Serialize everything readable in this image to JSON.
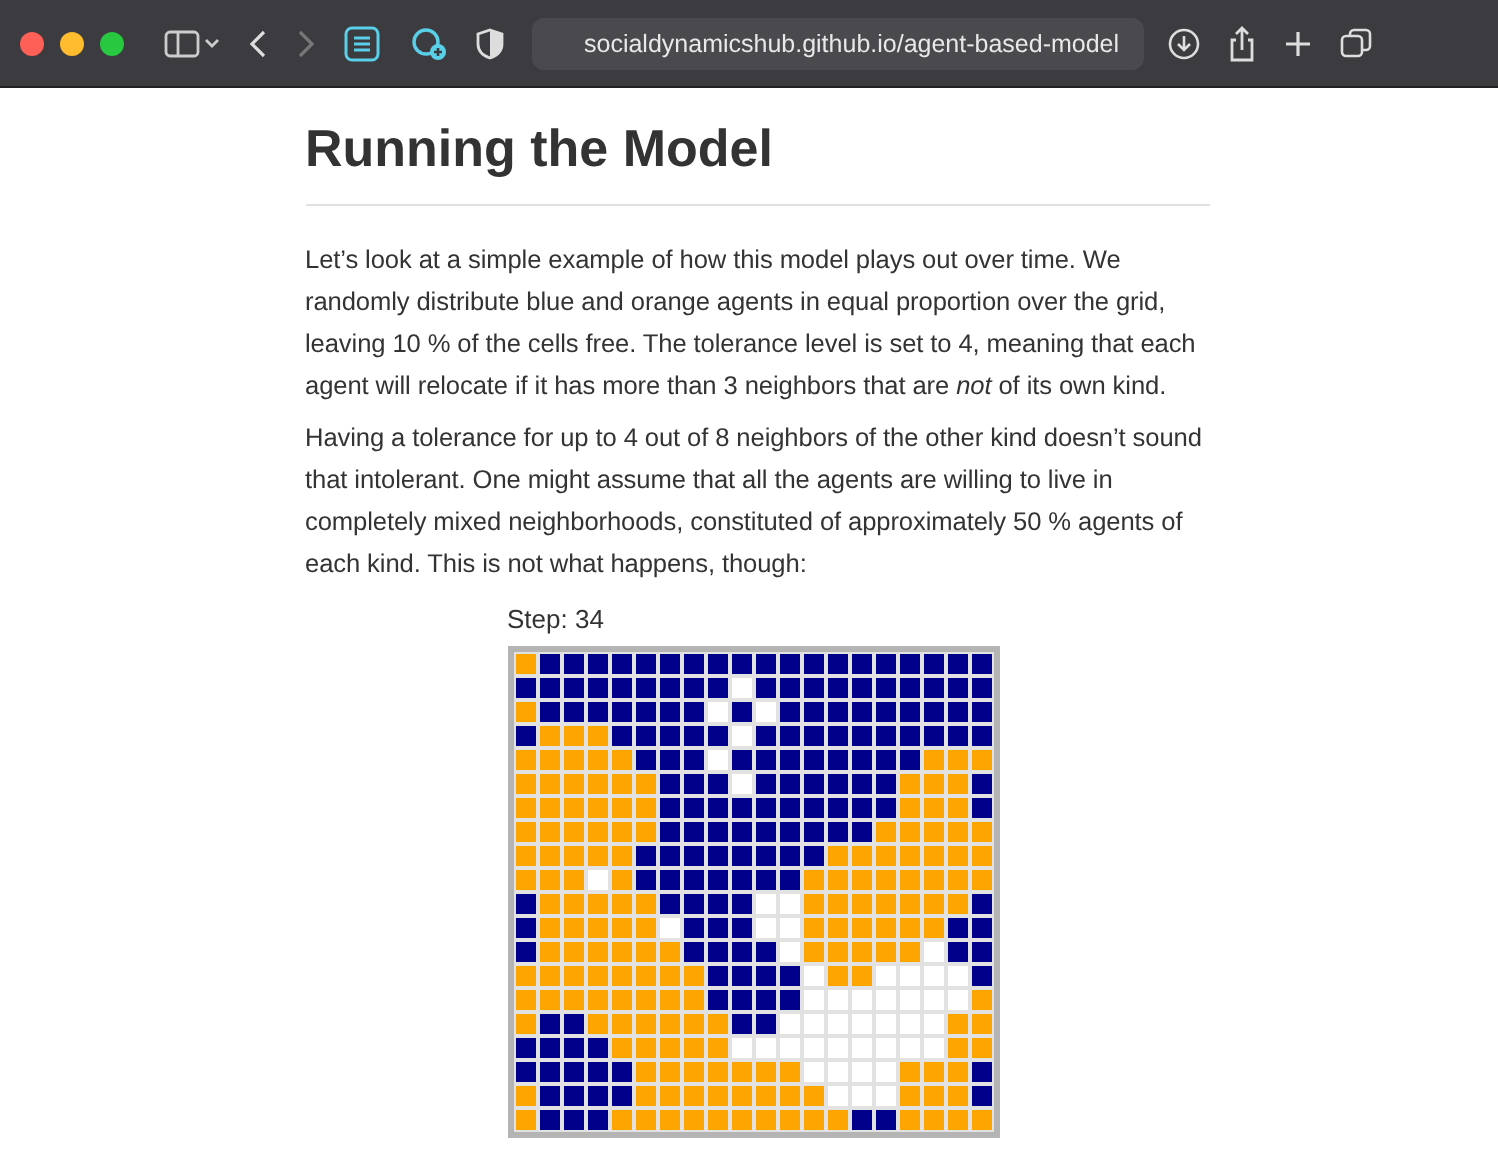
{
  "browser": {
    "url": "socialdynamicshub.github.io/agent-based-model"
  },
  "article": {
    "title": "Running the Model",
    "paragraphs": [
      "Let’s look at a simple example of how this model plays out over time. We randomly distribute blue and orange agents in equal proportion over the grid, leaving 10 % of the cells free. The tolerance level is set to 4, meaning that each agent will relocate if it has more than 3 neighbors that are *not* of its own kind.",
      "Having a tolerance for up to 4 out of 8 neighbors of the other kind doesn’t sound that intolerant. One might assume that all the agents are willing to live in completely mixed neighborhoods, constituted of approximately 50 % agents of each kind. This is not what happens, though:"
    ]
  },
  "simulation": {
    "step_label": "Step: 34",
    "rows": [
      [
        {
          "kind": "orange"
        },
        {
          "kind": "blue"
        },
        {
          "kind": "blue"
        },
        {
          "kind": "blue"
        },
        {
          "kind": "blue"
        },
        {
          "kind": "blue"
        },
        {
          "kind": "blue"
        },
        {
          "kind": "blue"
        },
        {
          "kind": "blue"
        },
        {
          "kind": "blue"
        },
        {
          "kind": "blue"
        },
        {
          "kind": "blue"
        },
        {
          "kind": "blue"
        },
        {
          "kind": "blue"
        },
        {
          "kind": "blue"
        },
        {
          "kind": "blue"
        },
        {
          "kind": "blue"
        },
        {
          "kind": "blue"
        },
        {
          "kind": "blue"
        },
        {
          "kind": "blue"
        }
      ],
      [
        {
          "kind": "blue"
        },
        {
          "kind": "blue"
        },
        {
          "kind": "blue"
        },
        {
          "kind": "blue"
        },
        {
          "kind": "blue"
        },
        {
          "kind": "blue"
        },
        {
          "kind": "blue"
        },
        {
          "kind": "blue"
        },
        {
          "kind": "blue"
        },
        {
          "kind": "empty"
        },
        {
          "kind": "blue"
        },
        {
          "kind": "blue"
        },
        {
          "kind": "blue"
        },
        {
          "kind": "blue"
        },
        {
          "kind": "blue"
        },
        {
          "kind": "blue"
        },
        {
          "kind": "blue"
        },
        {
          "kind": "blue"
        },
        {
          "kind": "blue"
        },
        {
          "kind": "blue"
        }
      ],
      [
        {
          "kind": "orange"
        },
        {
          "kind": "blue"
        },
        {
          "kind": "blue"
        },
        {
          "kind": "blue"
        },
        {
          "kind": "blue"
        },
        {
          "kind": "blue"
        },
        {
          "kind": "blue"
        },
        {
          "kind": "blue"
        },
        {
          "kind": "empty"
        },
        {
          "kind": "blue"
        },
        {
          "kind": "empty"
        },
        {
          "kind": "blue"
        },
        {
          "kind": "blue"
        },
        {
          "kind": "blue"
        },
        {
          "kind": "blue"
        },
        {
          "kind": "blue"
        },
        {
          "kind": "blue"
        },
        {
          "kind": "blue"
        },
        {
          "kind": "blue"
        },
        {
          "kind": "blue"
        }
      ],
      [
        {
          "kind": "blue"
        },
        {
          "kind": "orange"
        },
        {
          "kind": "orange"
        },
        {
          "kind": "orange"
        },
        {
          "kind": "blue"
        },
        {
          "kind": "blue"
        },
        {
          "kind": "blue"
        },
        {
          "kind": "blue"
        },
        {
          "kind": "blue"
        },
        {
          "kind": "empty"
        },
        {
          "kind": "blue"
        },
        {
          "kind": "blue"
        },
        {
          "kind": "blue"
        },
        {
          "kind": "blue"
        },
        {
          "kind": "blue"
        },
        {
          "kind": "blue"
        },
        {
          "kind": "blue"
        },
        {
          "kind": "blue"
        },
        {
          "kind": "blue"
        },
        {
          "kind": "blue"
        }
      ],
      [
        {
          "kind": "orange"
        },
        {
          "kind": "orange"
        },
        {
          "kind": "orange"
        },
        {
          "kind": "orange"
        },
        {
          "kind": "orange"
        },
        {
          "kind": "blue"
        },
        {
          "kind": "blue"
        },
        {
          "kind": "blue"
        },
        {
          "kind": "empty"
        },
        {
          "kind": "blue"
        },
        {
          "kind": "blue"
        },
        {
          "kind": "blue"
        },
        {
          "kind": "blue"
        },
        {
          "kind": "blue"
        },
        {
          "kind": "blue"
        },
        {
          "kind": "blue"
        },
        {
          "kind": "blue"
        },
        {
          "kind": "orange"
        },
        {
          "kind": "orange"
        },
        {
          "kind": "orange"
        }
      ],
      [
        {
          "kind": "orange"
        },
        {
          "kind": "orange"
        },
        {
          "kind": "orange"
        },
        {
          "kind": "orange"
        },
        {
          "kind": "orange"
        },
        {
          "kind": "orange"
        },
        {
          "kind": "blue"
        },
        {
          "kind": "blue"
        },
        {
          "kind": "blue"
        },
        {
          "kind": "empty"
        },
        {
          "kind": "blue"
        },
        {
          "kind": "blue"
        },
        {
          "kind": "blue"
        },
        {
          "kind": "blue"
        },
        {
          "kind": "blue"
        },
        {
          "kind": "blue"
        },
        {
          "kind": "orange"
        },
        {
          "kind": "orange"
        },
        {
          "kind": "orange"
        },
        {
          "kind": "blue"
        }
      ],
      [
        {
          "kind": "orange"
        },
        {
          "kind": "orange"
        },
        {
          "kind": "orange"
        },
        {
          "kind": "orange"
        },
        {
          "kind": "orange"
        },
        {
          "kind": "orange"
        },
        {
          "kind": "blue"
        },
        {
          "kind": "blue"
        },
        {
          "kind": "blue"
        },
        {
          "kind": "blue"
        },
        {
          "kind": "blue"
        },
        {
          "kind": "blue"
        },
        {
          "kind": "blue"
        },
        {
          "kind": "blue"
        },
        {
          "kind": "blue"
        },
        {
          "kind": "blue"
        },
        {
          "kind": "orange"
        },
        {
          "kind": "orange"
        },
        {
          "kind": "orange"
        },
        {
          "kind": "blue"
        }
      ],
      [
        {
          "kind": "orange"
        },
        {
          "kind": "orange"
        },
        {
          "kind": "orange"
        },
        {
          "kind": "orange"
        },
        {
          "kind": "orange"
        },
        {
          "kind": "orange"
        },
        {
          "kind": "blue"
        },
        {
          "kind": "blue"
        },
        {
          "kind": "blue"
        },
        {
          "kind": "blue"
        },
        {
          "kind": "blue"
        },
        {
          "kind": "blue"
        },
        {
          "kind": "blue"
        },
        {
          "kind": "blue"
        },
        {
          "kind": "blue"
        },
        {
          "kind": "orange"
        },
        {
          "kind": "orange"
        },
        {
          "kind": "orange"
        },
        {
          "kind": "orange"
        },
        {
          "kind": "orange"
        }
      ],
      [
        {
          "kind": "orange"
        },
        {
          "kind": "orange"
        },
        {
          "kind": "orange"
        },
        {
          "kind": "orange"
        },
        {
          "kind": "orange"
        },
        {
          "kind": "blue"
        },
        {
          "kind": "blue"
        },
        {
          "kind": "blue"
        },
        {
          "kind": "blue"
        },
        {
          "kind": "blue"
        },
        {
          "kind": "blue"
        },
        {
          "kind": "blue"
        },
        {
          "kind": "blue"
        },
        {
          "kind": "orange"
        },
        {
          "kind": "orange"
        },
        {
          "kind": "orange"
        },
        {
          "kind": "orange"
        },
        {
          "kind": "orange"
        },
        {
          "kind": "orange"
        },
        {
          "kind": "orange"
        }
      ],
      [
        {
          "kind": "orange"
        },
        {
          "kind": "orange"
        },
        {
          "kind": "orange"
        },
        {
          "kind": "empty"
        },
        {
          "kind": "orange"
        },
        {
          "kind": "blue"
        },
        {
          "kind": "blue"
        },
        {
          "kind": "blue"
        },
        {
          "kind": "blue"
        },
        {
          "kind": "blue"
        },
        {
          "kind": "blue"
        },
        {
          "kind": "blue"
        },
        {
          "kind": "orange"
        },
        {
          "kind": "orange"
        },
        {
          "kind": "orange"
        },
        {
          "kind": "orange"
        },
        {
          "kind": "orange"
        },
        {
          "kind": "orange"
        },
        {
          "kind": "orange"
        },
        {
          "kind": "orange"
        }
      ],
      [
        {
          "kind": "blue"
        },
        {
          "kind": "orange"
        },
        {
          "kind": "orange"
        },
        {
          "kind": "orange"
        },
        {
          "kind": "orange"
        },
        {
          "kind": "orange"
        },
        {
          "kind": "blue"
        },
        {
          "kind": "blue"
        },
        {
          "kind": "blue"
        },
        {
          "kind": "blue"
        },
        {
          "kind": "empty"
        },
        {
          "kind": "empty"
        },
        {
          "kind": "orange"
        },
        {
          "kind": "orange"
        },
        {
          "kind": "orange"
        },
        {
          "kind": "orange"
        },
        {
          "kind": "orange"
        },
        {
          "kind": "orange"
        },
        {
          "kind": "orange"
        },
        {
          "kind": "blue"
        }
      ],
      [
        {
          "kind": "blue"
        },
        {
          "kind": "orange"
        },
        {
          "kind": "orange"
        },
        {
          "kind": "orange"
        },
        {
          "kind": "orange"
        },
        {
          "kind": "orange"
        },
        {
          "kind": "empty"
        },
        {
          "kind": "blue"
        },
        {
          "kind": "blue"
        },
        {
          "kind": "blue"
        },
        {
          "kind": "empty"
        },
        {
          "kind": "empty"
        },
        {
          "kind": "orange"
        },
        {
          "kind": "orange"
        },
        {
          "kind": "orange"
        },
        {
          "kind": "orange"
        },
        {
          "kind": "orange"
        },
        {
          "kind": "orange"
        },
        {
          "kind": "blue"
        },
        {
          "kind": "blue"
        }
      ],
      [
        {
          "kind": "blue"
        },
        {
          "kind": "orange"
        },
        {
          "kind": "orange"
        },
        {
          "kind": "orange"
        },
        {
          "kind": "orange"
        },
        {
          "kind": "orange"
        },
        {
          "kind": "orange"
        },
        {
          "kind": "blue"
        },
        {
          "kind": "blue"
        },
        {
          "kind": "blue"
        },
        {
          "kind": "blue"
        },
        {
          "kind": "empty"
        },
        {
          "kind": "orange"
        },
        {
          "kind": "orange"
        },
        {
          "kind": "orange"
        },
        {
          "kind": "orange"
        },
        {
          "kind": "orange"
        },
        {
          "kind": "empty"
        },
        {
          "kind": "blue"
        },
        {
          "kind": "blue"
        }
      ],
      [
        {
          "kind": "orange"
        },
        {
          "kind": "orange"
        },
        {
          "kind": "orange"
        },
        {
          "kind": "orange"
        },
        {
          "kind": "orange"
        },
        {
          "kind": "orange"
        },
        {
          "kind": "orange"
        },
        {
          "kind": "orange"
        },
        {
          "kind": "blue"
        },
        {
          "kind": "blue"
        },
        {
          "kind": "blue"
        },
        {
          "kind": "blue"
        },
        {
          "kind": "empty"
        },
        {
          "kind": "orange"
        },
        {
          "kind": "orange"
        },
        {
          "kind": "empty"
        },
        {
          "kind": "empty"
        },
        {
          "kind": "empty"
        },
        {
          "kind": "empty"
        },
        {
          "kind": "blue"
        }
      ],
      [
        {
          "kind": "orange"
        },
        {
          "kind": "orange"
        },
        {
          "kind": "orange"
        },
        {
          "kind": "orange"
        },
        {
          "kind": "orange"
        },
        {
          "kind": "orange"
        },
        {
          "kind": "orange"
        },
        {
          "kind": "orange"
        },
        {
          "kind": "blue"
        },
        {
          "kind": "blue"
        },
        {
          "kind": "blue"
        },
        {
          "kind": "blue"
        },
        {
          "kind": "empty"
        },
        {
          "kind": "empty"
        },
        {
          "kind": "empty"
        },
        {
          "kind": "empty"
        },
        {
          "kind": "empty"
        },
        {
          "kind": "empty"
        },
        {
          "kind": "empty"
        },
        {
          "kind": "orange"
        }
      ],
      [
        {
          "kind": "orange"
        },
        {
          "kind": "blue"
        },
        {
          "kind": "blue"
        },
        {
          "kind": "orange"
        },
        {
          "kind": "orange"
        },
        {
          "kind": "orange"
        },
        {
          "kind": "orange"
        },
        {
          "kind": "orange"
        },
        {
          "kind": "orange"
        },
        {
          "kind": "blue"
        },
        {
          "kind": "blue"
        },
        {
          "kind": "empty"
        },
        {
          "kind": "empty"
        },
        {
          "kind": "empty"
        },
        {
          "kind": "empty"
        },
        {
          "kind": "empty"
        },
        {
          "kind": "empty"
        },
        {
          "kind": "empty"
        },
        {
          "kind": "orange"
        },
        {
          "kind": "orange"
        }
      ],
      [
        {
          "kind": "blue"
        },
        {
          "kind": "blue"
        },
        {
          "kind": "blue"
        },
        {
          "kind": "blue"
        },
        {
          "kind": "orange"
        },
        {
          "kind": "orange"
        },
        {
          "kind": "orange"
        },
        {
          "kind": "orange"
        },
        {
          "kind": "orange"
        },
        {
          "kind": "empty"
        },
        {
          "kind": "empty"
        },
        {
          "kind": "empty"
        },
        {
          "kind": "empty"
        },
        {
          "kind": "empty"
        },
        {
          "kind": "empty"
        },
        {
          "kind": "empty"
        },
        {
          "kind": "empty"
        },
        {
          "kind": "empty"
        },
        {
          "kind": "orange"
        },
        {
          "kind": "orange"
        }
      ],
      [
        {
          "kind": "blue"
        },
        {
          "kind": "blue"
        },
        {
          "kind": "blue"
        },
        {
          "kind": "blue"
        },
        {
          "kind": "blue"
        },
        {
          "kind": "orange"
        },
        {
          "kind": "orange"
        },
        {
          "kind": "orange"
        },
        {
          "kind": "orange"
        },
        {
          "kind": "orange"
        },
        {
          "kind": "orange"
        },
        {
          "kind": "orange"
        },
        {
          "kind": "empty"
        },
        {
          "kind": "empty"
        },
        {
          "kind": "empty"
        },
        {
          "kind": "empty"
        },
        {
          "kind": "orange"
        },
        {
          "kind": "orange"
        },
        {
          "kind": "orange"
        },
        {
          "kind": "blue"
        }
      ],
      [
        {
          "kind": "orange"
        },
        {
          "kind": "blue"
        },
        {
          "kind": "blue"
        },
        {
          "kind": "blue"
        },
        {
          "kind": "blue"
        },
        {
          "kind": "orange"
        },
        {
          "kind": "orange"
        },
        {
          "kind": "orange"
        },
        {
          "kind": "orange"
        },
        {
          "kind": "orange"
        },
        {
          "kind": "orange"
        },
        {
          "kind": "orange"
        },
        {
          "kind": "orange"
        },
        {
          "kind": "empty"
        },
        {
          "kind": "empty"
        },
        {
          "kind": "empty"
        },
        {
          "kind": "orange"
        },
        {
          "kind": "orange"
        },
        {
          "kind": "orange"
        },
        {
          "kind": "blue"
        }
      ],
      [
        {
          "kind": "orange"
        },
        {
          "kind": "blue"
        },
        {
          "kind": "blue"
        },
        {
          "kind": "blue"
        },
        {
          "kind": "orange"
        },
        {
          "kind": "orange"
        },
        {
          "kind": "orange"
        },
        {
          "kind": "orange"
        },
        {
          "kind": "orange"
        },
        {
          "kind": "orange"
        },
        {
          "kind": "orange"
        },
        {
          "kind": "orange"
        },
        {
          "kind": "orange"
        },
        {
          "kind": "orange"
        },
        {
          "kind": "blue"
        },
        {
          "kind": "blue"
        },
        {
          "kind": "orange"
        },
        {
          "kind": "orange"
        },
        {
          "kind": "orange"
        },
        {
          "kind": "orange"
        }
      ]
    ]
  }
}
